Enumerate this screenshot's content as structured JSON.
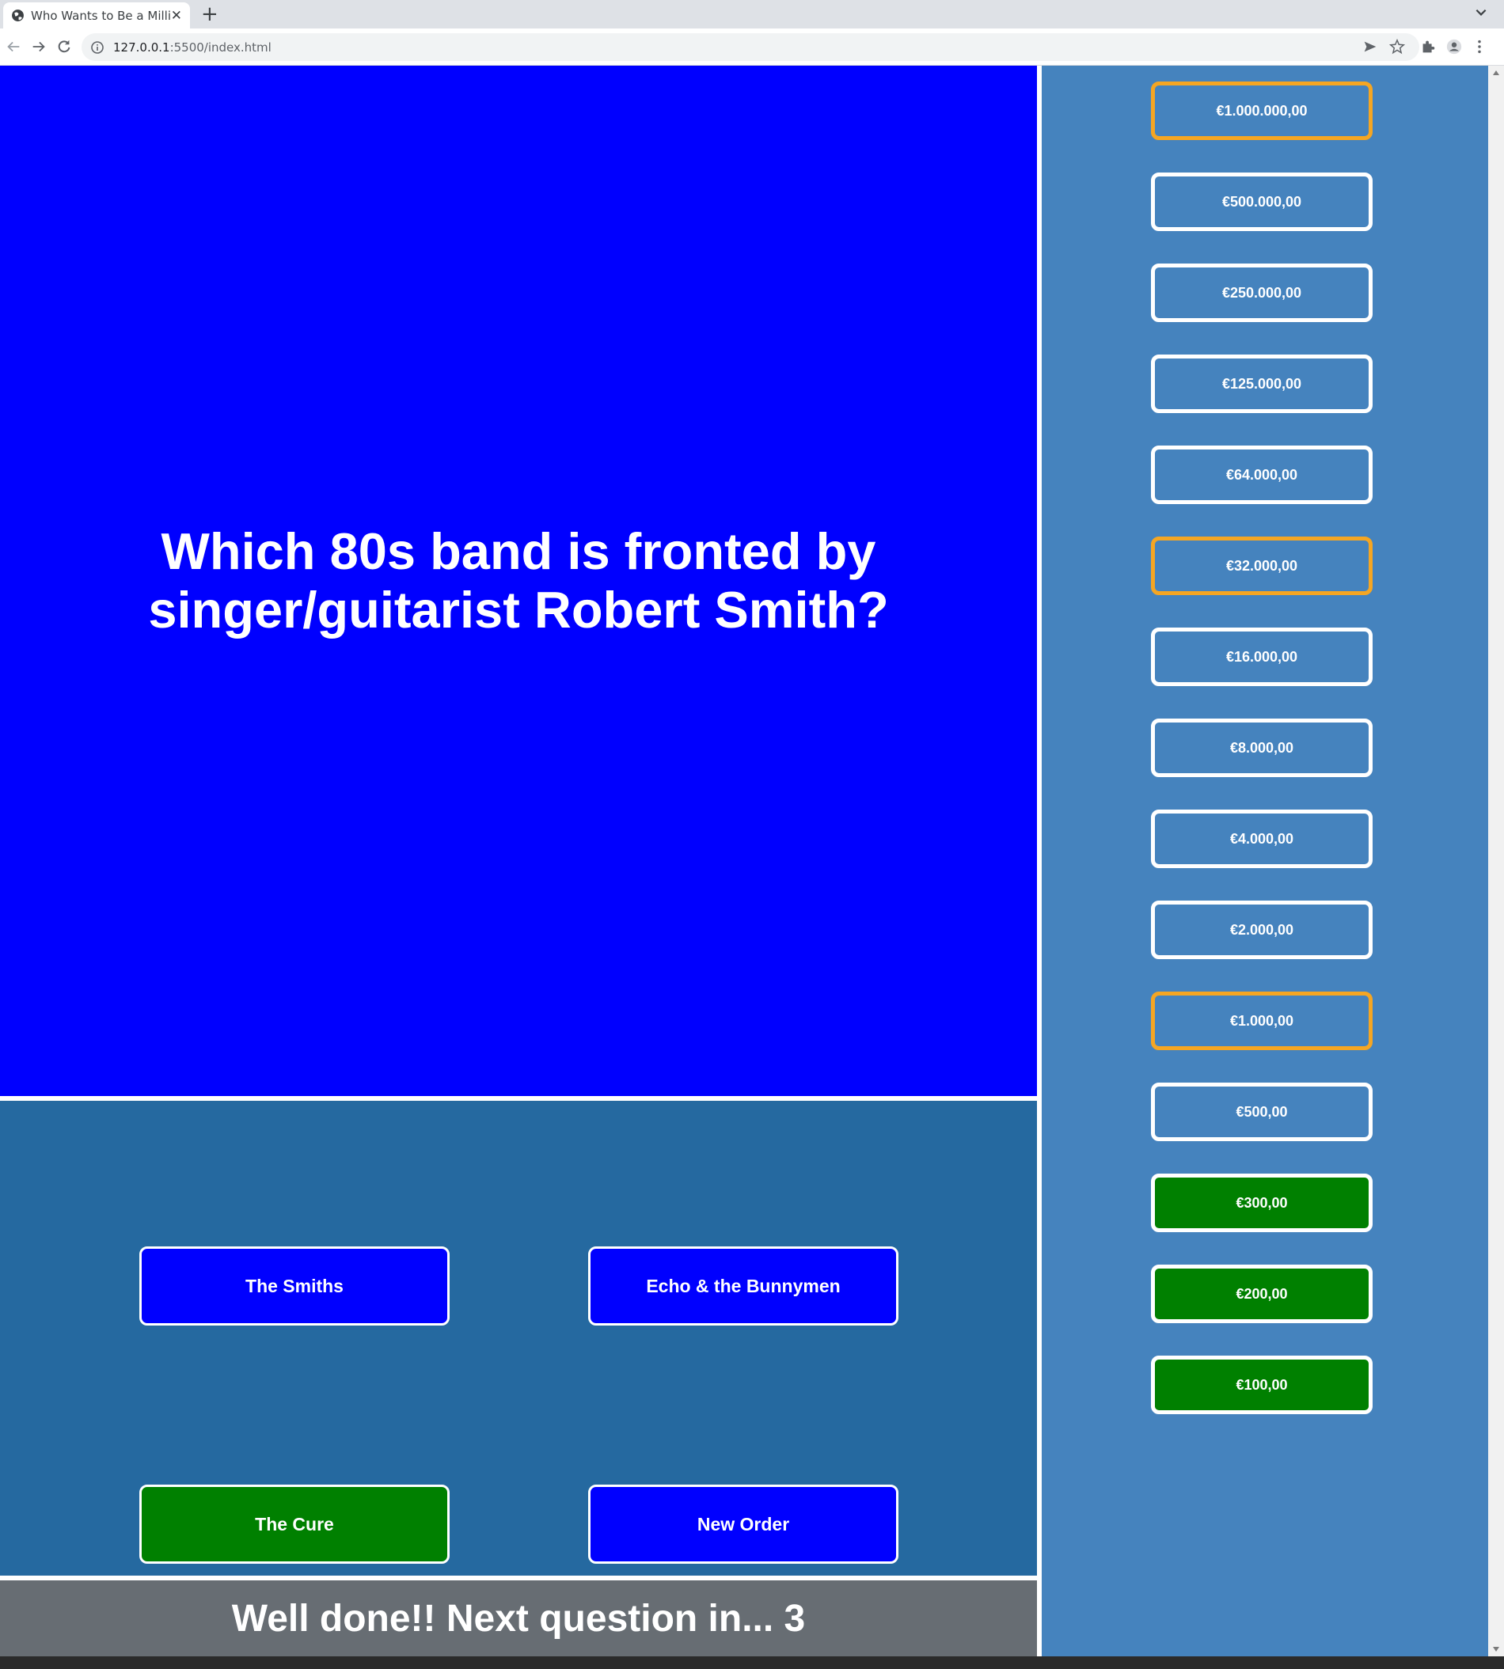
{
  "browser": {
    "tab_title": "Who Wants to Be a Millionaire",
    "url_host": "127.0.0.1",
    "url_rest": ":5500/index.html",
    "icons": [
      "globe-icon",
      "close-icon",
      "plus-icon",
      "chevron-down-icon",
      "back-icon",
      "forward-icon",
      "reload-icon",
      "info-icon",
      "send-icon",
      "star-icon",
      "puzzle-icon",
      "profile-icon",
      "more-icon"
    ]
  },
  "question": {
    "text": "Which 80s band is fronted by singer/guitarist Robert Smith?"
  },
  "answers": [
    {
      "label": "The Smiths",
      "state": "default",
      "color": "#0000ff"
    },
    {
      "label": "Echo & the Bunnymen",
      "state": "default",
      "color": "#0000ff"
    },
    {
      "label": "The Cure",
      "state": "correct",
      "color": "#008000"
    },
    {
      "label": "New Order",
      "state": "default",
      "color": "#0000ff"
    }
  ],
  "status": {
    "text": "Well done!! Next question in... 3"
  },
  "ladder": [
    {
      "amount": "€1.000.000,00",
      "state": "milestone"
    },
    {
      "amount": "€500.000,00",
      "state": "default"
    },
    {
      "amount": "€250.000,00",
      "state": "default"
    },
    {
      "amount": "€125.000,00",
      "state": "default"
    },
    {
      "amount": "€64.000,00",
      "state": "default"
    },
    {
      "amount": "€32.000,00",
      "state": "milestone"
    },
    {
      "amount": "€16.000,00",
      "state": "default"
    },
    {
      "amount": "€8.000,00",
      "state": "default"
    },
    {
      "amount": "€4.000,00",
      "state": "default"
    },
    {
      "amount": "€2.000,00",
      "state": "default"
    },
    {
      "amount": "€1.000,00",
      "state": "milestone"
    },
    {
      "amount": "€500,00",
      "state": "default"
    },
    {
      "amount": "€300,00",
      "state": "won"
    },
    {
      "amount": "€200,00",
      "state": "won"
    },
    {
      "amount": "€100,00",
      "state": "won"
    }
  ],
  "colors": {
    "question_bg": "#0000ff",
    "answers_bg": "#2569a0",
    "ladder_bg": "#4583be",
    "status_bg": "#676d73",
    "correct": "#008000",
    "milestone_border": "#f5a623",
    "default_border": "#ffffff"
  }
}
